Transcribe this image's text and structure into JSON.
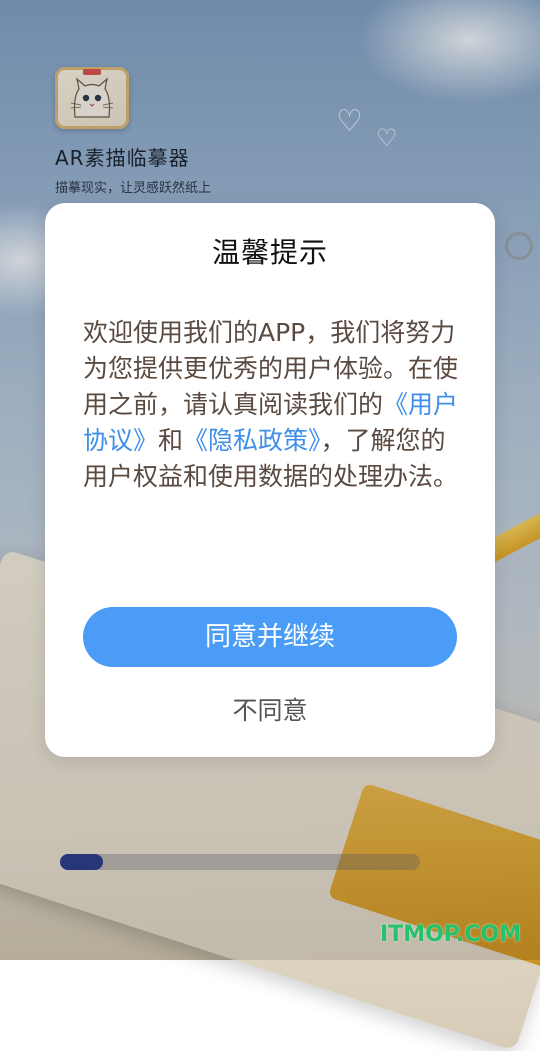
{
  "app": {
    "title": "AR素描临摹器",
    "slogan": "描摹现实，让灵感跃然纸上",
    "icon": "cat-sketch-app-icon"
  },
  "dialog": {
    "title": "温馨提示",
    "body_before": "欢迎使用我们的APP，我们将努力为您提供更优秀的用户体验。在使用之前，请认真阅读我们的",
    "user_agreement_link": "《用户协议》",
    "connector": "和",
    "privacy_policy_link": "《隐私政策》",
    "body_after": "，了解您的用户权益和使用数据的处理办法。",
    "agree_label": "同意并继续",
    "disagree_label": "不同意"
  },
  "progress": {
    "value_fraction": 0.12
  },
  "watermark": {
    "text": "ITMOP.COM"
  },
  "colors": {
    "accent": "#4b9cf6",
    "link": "#3f8fe8",
    "body_text": "#5a4a40",
    "progress_fill": "#27367a",
    "watermark": "#25c26b"
  }
}
